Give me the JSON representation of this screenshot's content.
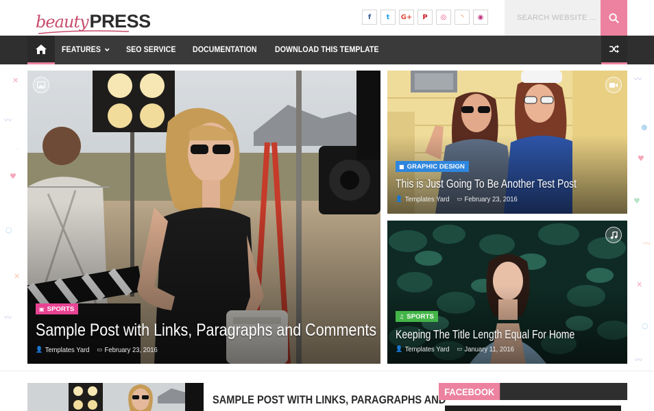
{
  "header": {
    "logo": {
      "script_text": "beauty",
      "bold_text": "PRESS"
    },
    "social_links": [
      {
        "icon": "facebook-icon",
        "glyph": "f",
        "color": "#3b5998"
      },
      {
        "icon": "twitter-icon",
        "glyph": "t",
        "color": "#1da1f2"
      },
      {
        "icon": "google-plus-icon",
        "glyph": "G+",
        "color": "#dd4b39"
      },
      {
        "icon": "pinterest-icon",
        "glyph": "P",
        "color": "#cb2027"
      },
      {
        "icon": "dribbble-icon",
        "glyph": "◎",
        "color": "#ea4c89"
      },
      {
        "icon": "rss-icon",
        "glyph": "◝",
        "color": "#f26522"
      },
      {
        "icon": "instagram-icon",
        "glyph": "◉",
        "color": "#c13584"
      }
    ],
    "search": {
      "placeholder": "SEARCH WEBSITE ..."
    }
  },
  "nav": {
    "items": [
      {
        "label": "FEATURES",
        "has_dropdown": true
      },
      {
        "label": "SEO SERVICE"
      },
      {
        "label": "DOCUMENTATION"
      },
      {
        "label": "DOWNLOAD THIS TEMPLATE"
      }
    ]
  },
  "featured": {
    "main": {
      "category": "SPORTS",
      "category_color": "#e84393",
      "title": "Sample Post with Links, Paragraphs and Comments",
      "author": "Templates Yard",
      "date": "February 23, 2016",
      "format_icon": "image-icon"
    },
    "top": {
      "category": "GRAPHIC DESIGN",
      "category_color": "#2e86de",
      "title": "This is Just Going To Be Another Test Post",
      "author": "Templates Yard",
      "date": "February 23, 2016",
      "format_icon": "video-icon"
    },
    "bottom": {
      "category": "SPORTS",
      "category_color": "#44b549",
      "title": "Keeping The Title Length Equal For Home",
      "author": "Templates Yard",
      "date": "January 11, 2016",
      "format_icon": "music-icon"
    }
  },
  "recent": {
    "title": "SAMPLE POST WITH LINKS, PARAGRAPHS AND"
  },
  "sidebar": {
    "widget_title": "FACEBOOK"
  },
  "colors": {
    "accent": "#ec82a0",
    "nav_bg": "#3a3a3a"
  }
}
